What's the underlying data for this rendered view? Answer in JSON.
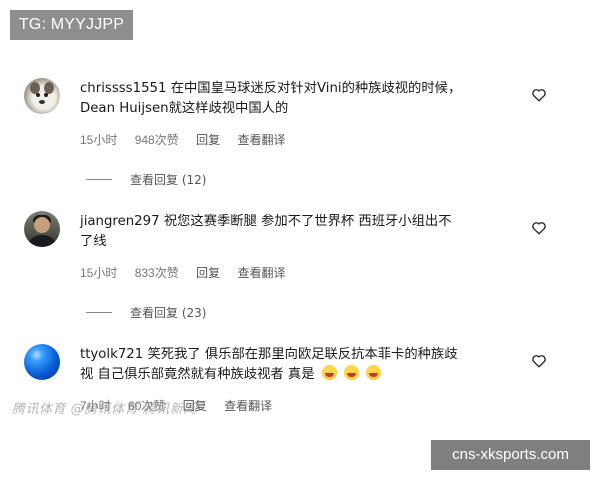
{
  "badge": {
    "label": "TG: MYYJJPP"
  },
  "comments": [
    {
      "username": "chrissss1551",
      "text_line1": "在中国皇马球迷反对针对Vini的种族歧视的时候，",
      "text_line2": "Dean Huijsen就这样歧视中国人的",
      "time": "15小时",
      "likes": "948次赞",
      "reply": "回复",
      "translate": "查看翻译",
      "view_replies": "查看回复 (12)"
    },
    {
      "username": "jiangren297",
      "text_line1": "祝您这赛季断腿 参加不了世界杯 西班牙小组出不",
      "text_line2": "了线",
      "time": "15小时",
      "likes": "833次赞",
      "reply": "回复",
      "translate": "查看翻译",
      "view_replies": "查看回复 (23)"
    },
    {
      "username": "ttyolk721",
      "text_line1": "笑死我了 俱乐部在那里向欧足联反抗本菲卡的种族歧",
      "text_line2": "视 自己俱乐部竟然就有种族歧视者 真是",
      "time": "7小时",
      "likes": "60次赞",
      "reply": "回复",
      "translate": "查看翻译"
    }
  ],
  "watermark": {
    "text": "腾讯体育 @腾讯体育 腾讯新闻"
  },
  "site": {
    "label": "cns-xksports.com"
  }
}
